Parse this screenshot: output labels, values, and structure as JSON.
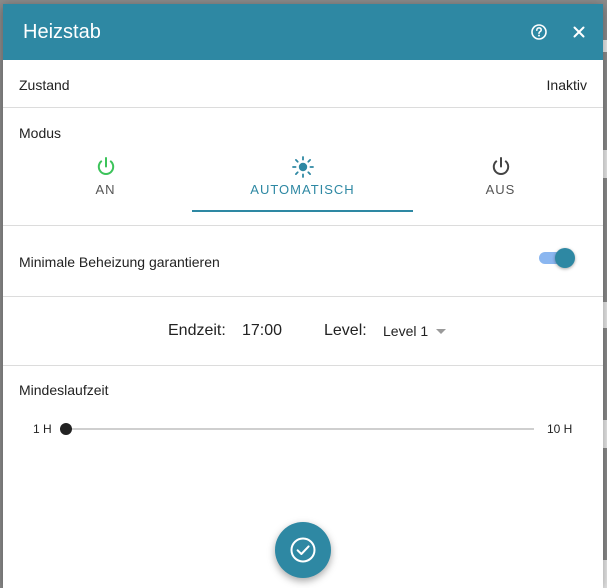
{
  "dialog": {
    "title": "Heizstab"
  },
  "state": {
    "label": "Zustand",
    "value": "Inaktiv"
  },
  "mode": {
    "label": "Modus",
    "options": [
      {
        "label": "AN",
        "icon": "power-icon",
        "color": "#3cc35a"
      },
      {
        "label": "AUTOMATISCH",
        "icon": "sun-icon",
        "color": "#2e88a3"
      },
      {
        "label": "AUS",
        "icon": "power-icon",
        "color": "#444444"
      }
    ],
    "selected": "AUTOMATISCH"
  },
  "min_heating": {
    "label": "Minimale Beheizung garantieren",
    "enabled": true
  },
  "schedule": {
    "end_label": "Endzeit:",
    "end_value": "17:00",
    "level_label": "Level:",
    "level_value": "Level 1"
  },
  "runtime": {
    "label": "Mindeslaufzeit",
    "min_label": "1 H",
    "max_label": "10 H",
    "min": 1,
    "max": 10,
    "value": 1
  },
  "colors": {
    "accent": "#2e88a3"
  }
}
